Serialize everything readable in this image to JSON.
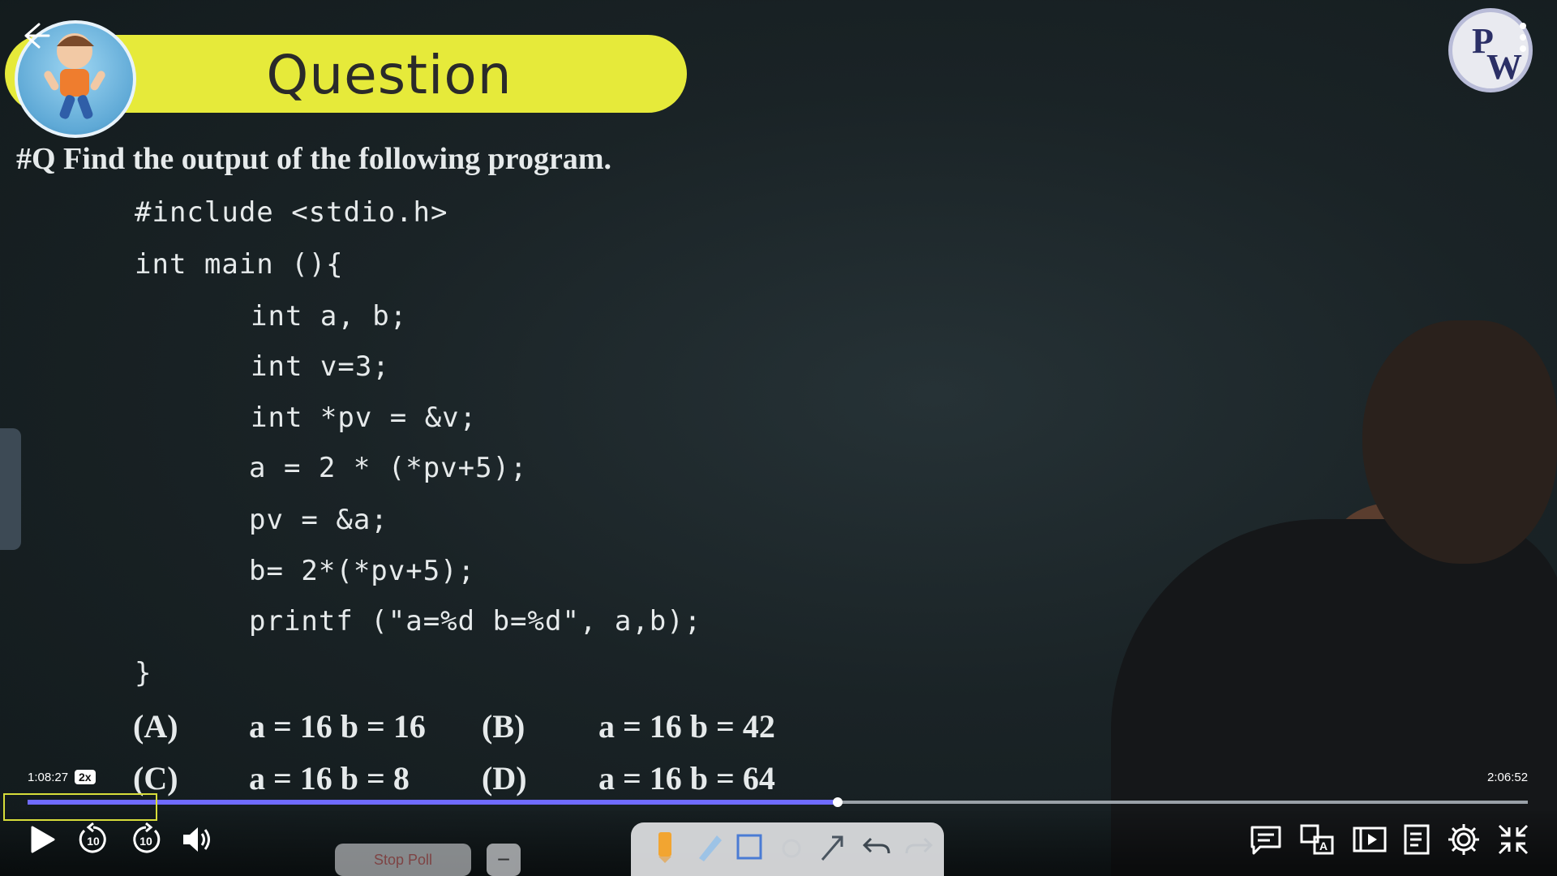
{
  "header": {
    "title": "Question"
  },
  "question": {
    "text": "#Q Find the output of the following program."
  },
  "code": {
    "lines": [
      "#include <stdio.h>",
      "int main (){",
      "int a, b;",
      "int v=3;",
      "int *pv = &v;",
      "a = 2 * (*pv+5);",
      "pv = &a;",
      "b= 2*(*pv+5);",
      "printf (\"a=%d b=%d\", a,b);",
      "}"
    ]
  },
  "options": [
    {
      "label": "(A)",
      "text": "a = 16 b = 16"
    },
    {
      "label": "(B)",
      "text": "a = 16 b = 42"
    },
    {
      "label": "(C)",
      "text": "a = 16 b = 8"
    },
    {
      "label": "(D)",
      "text": "a = 16 b = 64"
    }
  ],
  "player": {
    "current_time": "1:08:27",
    "speed": "2x",
    "total_time": "2:06:52",
    "progress_fraction": 0.54,
    "accent_color": "#6f6bff"
  },
  "controls": {
    "left": [
      "play-icon",
      "rewind-10-icon",
      "forward-10-icon",
      "volume-icon"
    ],
    "skip_label": "10",
    "right": [
      "chat-icon",
      "translate-icon",
      "video-panel-icon",
      "notes-icon",
      "settings-icon",
      "exit-fullscreen-icon"
    ]
  },
  "draw_toolbar": {
    "stop_poll_label": "Stop Poll",
    "tools": [
      "pen-icon",
      "highlighter-icon",
      "rectangle-icon",
      "circle-icon",
      "arrow-icon",
      "undo-icon",
      "redo-icon"
    ]
  },
  "brand": {
    "logo_text": "PW",
    "banner_color": "#e6ea3a"
  }
}
